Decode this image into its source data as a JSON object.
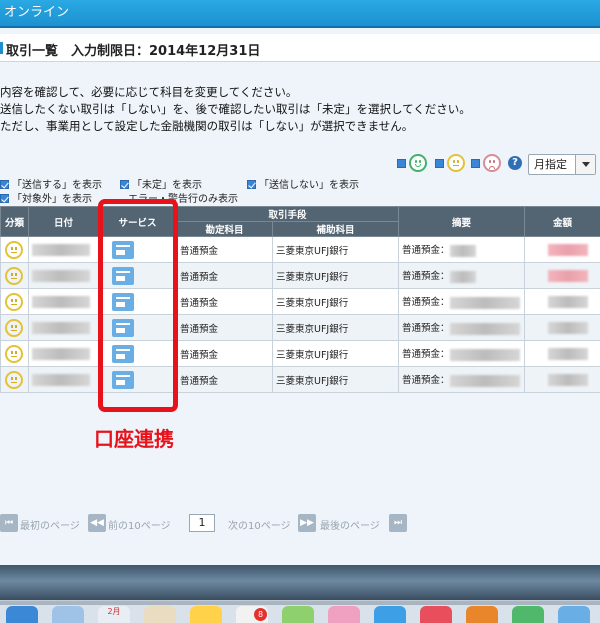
{
  "app": {
    "title": "オンライン"
  },
  "header": {
    "title": "取引一覧　入力制限日：2014年12月31日"
  },
  "instructions": [
    "内容を確認して、必要に応じて科目を変更してください。",
    "送信したくない取引は「しない」を、後で確認したい取引は「未定」を選択してください。",
    "ただし、事業用として設定した金融機関の取引は「しない」が選択できません。"
  ],
  "filters": {
    "row1": [
      "「送信する」を表示",
      "「未定」を表示",
      "「送信しない」を表示"
    ],
    "row2": [
      "「対象外」を表示",
      "エラー・警告行のみ表示"
    ]
  },
  "toolbar": {
    "help_label": "?",
    "month_select": "月指定"
  },
  "table": {
    "headers": {
      "category": "分類",
      "date": "日付",
      "service": "サービス",
      "method": "取引手段",
      "account": "勘定科目",
      "sub_account": "補助科目",
      "summary": "摘要",
      "amount": "金額"
    },
    "rows": [
      {
        "account": "普通預金",
        "sub_account": "三菱東京UFJ銀行",
        "summary": "普通預金："
      },
      {
        "account": "普通預金",
        "sub_account": "三菱東京UFJ銀行",
        "summary": "普通預金："
      },
      {
        "account": "普通預金",
        "sub_account": "三菱東京UFJ銀行",
        "summary": "普通預金："
      },
      {
        "account": "普通預金",
        "sub_account": "三菱東京UFJ銀行",
        "summary": "普通預金："
      },
      {
        "account": "普通預金",
        "sub_account": "三菱東京UFJ銀行",
        "summary": "普通預金："
      },
      {
        "account": "普通預金",
        "sub_account": "三菱東京UFJ銀行",
        "summary": "普通預金："
      }
    ]
  },
  "annotation": {
    "label": "口座連携",
    "color": "#e8121b"
  },
  "pager": {
    "first": "最初のページ",
    "prev10": "前の10ページ",
    "page": "1",
    "next10": "次の10ページ",
    "last": "最後のページ"
  },
  "dock": {
    "badge": "8",
    "calendar": "2月"
  }
}
